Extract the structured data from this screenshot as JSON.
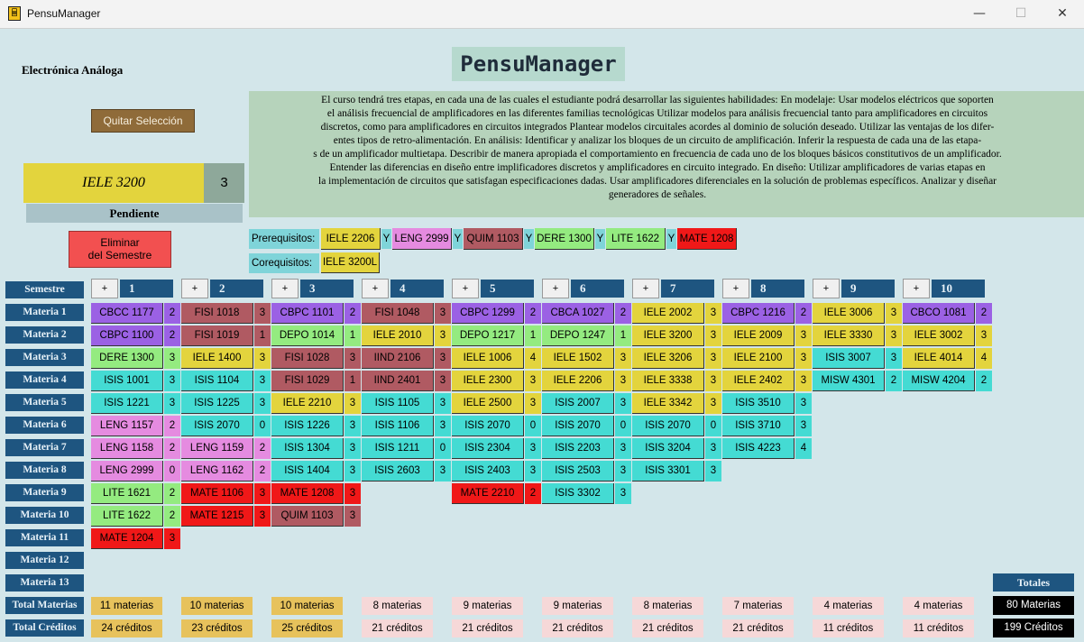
{
  "window": {
    "title": "PensuManager",
    "app_icon": "app-icon",
    "controls": [
      "—",
      "☐",
      "✕"
    ]
  },
  "logo": "PensuManager",
  "course": {
    "name": "Electrónica Análoga",
    "code": "IELE 3200",
    "credits": "3",
    "status": "Pendiente",
    "description_lines": [
      "El curso tendrá tres etapas, en cada una de las cuales el estudiante podrá desarrollar las siguientes habilidades:  En modelaje: Usar modelos eléctricos que soporten",
      "el análisis frecuencial de amplificadores en las diferentes familias tecnológicas Utilizar modelos para análisis frecuencial tanto para amplificadores en circuitos",
      "discretos, como para amplificadores en circuitos integrados Plantear modelos circuitales acordes al dominio de solución deseado. Utilizar las ventajas de los difer-",
      "entes tipos de retro-alimentación.   En análisis: Identificar y analizar los bloques de un circuito de amplificación. Inferir la respuesta de cada una de las etapa-",
      "s de un amplificador multietapa. Describir de manera apropiada el comportamiento en frecuencia de cada uno de los bloques básicos constitutivos de un amplificador.",
      "Entender las diferencias en diseño entre  implificadores discretos y amplificadores en circuito integrado.   En diseño: Utilizar amplificadores de varias etapas en",
      "la implementación de circuitos que satisfagan especificaciones dadas. Usar amplificadores diferenciales en la solución de problemas específicos. Analizar y diseñar",
      "generadores de señales."
    ]
  },
  "buttons": {
    "quitar": "Quitar Selección",
    "eliminar_line1": "Eliminar",
    "eliminar_line2": "del Semestre"
  },
  "prereq_label": "Prerequisitos:",
  "coreq_label": "Corequisitos:",
  "prerequisites": [
    {
      "code": "IELE 2206",
      "color": "#e3d43d"
    },
    {
      "code": "LENG 2999",
      "color": "#e58be0"
    },
    {
      "code": "QUIM 1103",
      "color": "#b05a62"
    },
    {
      "code": "DERE 1300",
      "color": "#94eb80"
    },
    {
      "code": "LITE 1622",
      "color": "#94eb80"
    },
    {
      "code": "MATE 1208",
      "color": "#f01818"
    }
  ],
  "y_sep": "Y",
  "corequisites": [
    {
      "code": "IELE 3200L",
      "color": "#e3d43d"
    }
  ],
  "semester_header_label": "Semestre",
  "plus_label": "+",
  "row_labels": [
    "Materia 1",
    "Materia 2",
    "Materia 3",
    "Materia 4",
    "Materia 5",
    "Materia 6",
    "Materia 7",
    "Materia 8",
    "Materia 9",
    "Materia 10",
    "Materia 11",
    "Materia 12",
    "Materia 13"
  ],
  "total_materias_label": "Total Materias",
  "total_creditos_label": "Total Créditos",
  "colors": {
    "purple": "#9b61e4",
    "pink": "#e58be0",
    "red": "#f01818",
    "rose": "#b05a62",
    "green": "#94eb80",
    "yellow": "#e3d43d",
    "cyan": "#44dbd3",
    "total_gold": "#e7c25c",
    "total_pink": "#f6d8d8",
    "header_blue": "#1e5580"
  },
  "semesters": [
    {
      "number": "1",
      "courses": [
        {
          "code": "CBCC 1177",
          "cr": "2",
          "c": "purple"
        },
        {
          "code": "CBPC 1100",
          "cr": "2",
          "c": "purple"
        },
        {
          "code": "DERE 1300",
          "cr": "3",
          "c": "green"
        },
        {
          "code": "ISIS 1001",
          "cr": "3",
          "c": "cyan"
        },
        {
          "code": "ISIS 1221",
          "cr": "3",
          "c": "cyan"
        },
        {
          "code": "LENG 1157",
          "cr": "2",
          "c": "pink"
        },
        {
          "code": "LENG 1158",
          "cr": "2",
          "c": "pink"
        },
        {
          "code": "LENG 2999",
          "cr": "0",
          "c": "pink"
        },
        {
          "code": "LITE 1621",
          "cr": "2",
          "c": "green"
        },
        {
          "code": "LITE 1622",
          "cr": "2",
          "c": "green"
        },
        {
          "code": "MATE 1204",
          "cr": "3",
          "c": "red"
        }
      ],
      "total_materias": "11 materias",
      "total_creditos": "24 créditos",
      "tc": "total_gold"
    },
    {
      "number": "2",
      "courses": [
        {
          "code": "FISI 1018",
          "cr": "3",
          "c": "rose"
        },
        {
          "code": "FISI 1019",
          "cr": "1",
          "c": "rose"
        },
        {
          "code": "IELE 1400",
          "cr": "3",
          "c": "yellow"
        },
        {
          "code": "ISIS 1104",
          "cr": "3",
          "c": "cyan"
        },
        {
          "code": "ISIS 1225",
          "cr": "3",
          "c": "cyan"
        },
        {
          "code": "ISIS 2070",
          "cr": "0",
          "c": "cyan"
        },
        {
          "code": "LENG 1159",
          "cr": "2",
          "c": "pink"
        },
        {
          "code": "LENG 1162",
          "cr": "2",
          "c": "pink"
        },
        {
          "code": "MATE 1106",
          "cr": "3",
          "c": "red"
        },
        {
          "code": "MATE 1215",
          "cr": "3",
          "c": "red"
        }
      ],
      "total_materias": "10 materias",
      "total_creditos": "23 créditos",
      "tc": "total_gold"
    },
    {
      "number": "3",
      "courses": [
        {
          "code": "CBPC 1101",
          "cr": "2",
          "c": "purple"
        },
        {
          "code": "DEPO 1014",
          "cr": "1",
          "c": "green"
        },
        {
          "code": "FISI 1028",
          "cr": "3",
          "c": "rose"
        },
        {
          "code": "FISI 1029",
          "cr": "1",
          "c": "rose"
        },
        {
          "code": "IELE 2210",
          "cr": "3",
          "c": "yellow"
        },
        {
          "code": "ISIS 1226",
          "cr": "3",
          "c": "cyan"
        },
        {
          "code": "ISIS 1304",
          "cr": "3",
          "c": "cyan"
        },
        {
          "code": "ISIS 1404",
          "cr": "3",
          "c": "cyan"
        },
        {
          "code": "MATE 1208",
          "cr": "3",
          "c": "red"
        },
        {
          "code": "QUIM 1103",
          "cr": "3",
          "c": "rose"
        }
      ],
      "total_materias": "10 materias",
      "total_creditos": "25 créditos",
      "tc": "total_gold"
    },
    {
      "number": "4",
      "courses": [
        {
          "code": "FISI 1048",
          "cr": "3",
          "c": "rose"
        },
        {
          "code": "IELE 2010",
          "cr": "3",
          "c": "yellow"
        },
        {
          "code": "IIND 2106",
          "cr": "3",
          "c": "rose"
        },
        {
          "code": "IIND 2401",
          "cr": "3",
          "c": "rose"
        },
        {
          "code": "ISIS 1105",
          "cr": "3",
          "c": "cyan"
        },
        {
          "code": "ISIS 1106",
          "cr": "3",
          "c": "cyan"
        },
        {
          "code": "ISIS 1211",
          "cr": "0",
          "c": "cyan"
        },
        {
          "code": "ISIS 2603",
          "cr": "3",
          "c": "cyan"
        }
      ],
      "total_materias": "8 materias",
      "total_creditos": "21 créditos",
      "tc": "total_pink"
    },
    {
      "number": "5",
      "courses": [
        {
          "code": "CBPC 1299",
          "cr": "2",
          "c": "purple"
        },
        {
          "code": "DEPO 1217",
          "cr": "1",
          "c": "green"
        },
        {
          "code": "IELE 1006",
          "cr": "4",
          "c": "yellow"
        },
        {
          "code": "IELE 2300",
          "cr": "3",
          "c": "yellow"
        },
        {
          "code": "IELE 2500",
          "cr": "3",
          "c": "yellow"
        },
        {
          "code": "ISIS 2070",
          "cr": "0",
          "c": "cyan"
        },
        {
          "code": "ISIS 2304",
          "cr": "3",
          "c": "cyan"
        },
        {
          "code": "ISIS 2403",
          "cr": "3",
          "c": "cyan"
        },
        {
          "code": "MATE 2210",
          "cr": "2",
          "c": "red"
        }
      ],
      "total_materias": "9 materias",
      "total_creditos": "21 créditos",
      "tc": "total_pink"
    },
    {
      "number": "6",
      "courses": [
        {
          "code": "CBCA 1027",
          "cr": "2",
          "c": "purple"
        },
        {
          "code": "DEPO 1247",
          "cr": "1",
          "c": "green"
        },
        {
          "code": "IELE 1502",
          "cr": "3",
          "c": "yellow"
        },
        {
          "code": "IELE 2206",
          "cr": "3",
          "c": "yellow"
        },
        {
          "code": "ISIS 2007",
          "cr": "3",
          "c": "cyan"
        },
        {
          "code": "ISIS 2070",
          "cr": "0",
          "c": "cyan"
        },
        {
          "code": "ISIS 2203",
          "cr": "3",
          "c": "cyan"
        },
        {
          "code": "ISIS 2503",
          "cr": "3",
          "c": "cyan"
        },
        {
          "code": "ISIS 3302",
          "cr": "3",
          "c": "cyan"
        }
      ],
      "total_materias": "9 materias",
      "total_creditos": "21 créditos",
      "tc": "total_pink"
    },
    {
      "number": "7",
      "courses": [
        {
          "code": "IELE 2002",
          "cr": "3",
          "c": "yellow"
        },
        {
          "code": "IELE 3200",
          "cr": "3",
          "c": "yellow"
        },
        {
          "code": "IELE 3206",
          "cr": "3",
          "c": "yellow"
        },
        {
          "code": "IELE 3338",
          "cr": "3",
          "c": "yellow"
        },
        {
          "code": "IELE 3342",
          "cr": "3",
          "c": "yellow"
        },
        {
          "code": "ISIS 2070",
          "cr": "0",
          "c": "cyan"
        },
        {
          "code": "ISIS 3204",
          "cr": "3",
          "c": "cyan"
        },
        {
          "code": "ISIS 3301",
          "cr": "3",
          "c": "cyan"
        }
      ],
      "total_materias": "8 materias",
      "total_creditos": "21 créditos",
      "tc": "total_pink"
    },
    {
      "number": "8",
      "courses": [
        {
          "code": "CBPC 1216",
          "cr": "2",
          "c": "purple"
        },
        {
          "code": "IELE 2009",
          "cr": "3",
          "c": "yellow"
        },
        {
          "code": "IELE 2100",
          "cr": "3",
          "c": "yellow"
        },
        {
          "code": "IELE 2402",
          "cr": "3",
          "c": "yellow"
        },
        {
          "code": "ISIS 3510",
          "cr": "3",
          "c": "cyan"
        },
        {
          "code": "ISIS 3710",
          "cr": "3",
          "c": "cyan"
        },
        {
          "code": "ISIS 4223",
          "cr": "4",
          "c": "cyan"
        }
      ],
      "total_materias": "7 materias",
      "total_creditos": "21 créditos",
      "tc": "total_pink"
    },
    {
      "number": "9",
      "courses": [
        {
          "code": "IELE 3006",
          "cr": "3",
          "c": "yellow"
        },
        {
          "code": "IELE 3330",
          "cr": "3",
          "c": "yellow"
        },
        {
          "code": "ISIS 3007",
          "cr": "3",
          "c": "cyan"
        },
        {
          "code": "MISW 4301",
          "cr": "2",
          "c": "cyan"
        }
      ],
      "total_materias": "4 materias",
      "total_creditos": "11 créditos",
      "tc": "total_pink"
    },
    {
      "number": "10",
      "courses": [
        {
          "code": "CBCO 1081",
          "cr": "2",
          "c": "purple"
        },
        {
          "code": "IELE 3002",
          "cr": "3",
          "c": "yellow"
        },
        {
          "code": "IELE 4014",
          "cr": "4",
          "c": "yellow"
        },
        {
          "code": "MISW 4204",
          "cr": "2",
          "c": "cyan"
        }
      ],
      "total_materias": "4 materias",
      "total_creditos": "11 créditos",
      "tc": "total_pink"
    }
  ],
  "totals": {
    "header": "Totales",
    "materias": "80 Materias",
    "creditos": "199 Créditos"
  }
}
